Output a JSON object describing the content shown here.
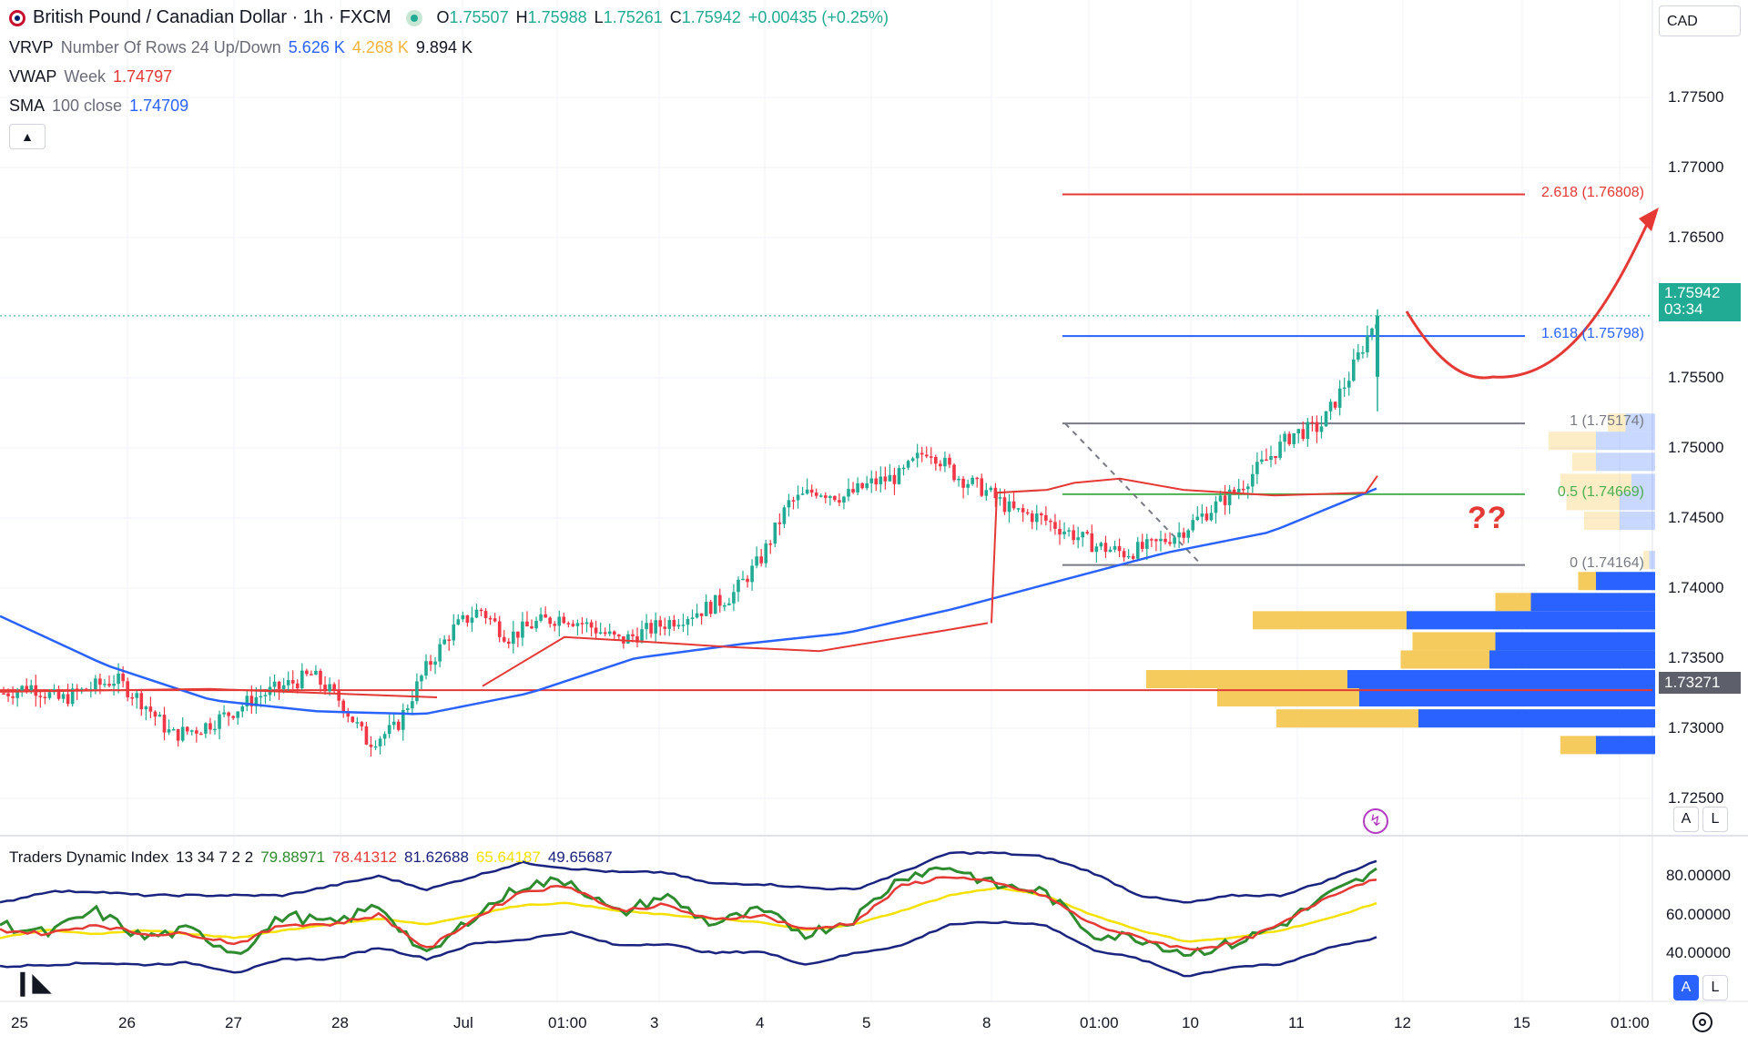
{
  "header": {
    "symbol": "British Pound / Canadian Dollar · 1h · FXCM",
    "open_label": "O",
    "open": "1.75507",
    "high_label": "H",
    "high": "1.75988",
    "low_label": "L",
    "low": "1.75261",
    "close_label": "C",
    "close": "1.75942",
    "change": "+0.00435 (+0.25%)"
  },
  "indicators": {
    "vrvp": {
      "name": "VRVP",
      "params": "Number Of Rows 24 Up/Down",
      "v1": "5.626 K",
      "v2": "4.268 K",
      "v3": "9.894 K"
    },
    "vwap": {
      "name": "VWAP",
      "params": "Week",
      "value": "1.74797"
    },
    "sma": {
      "name": "SMA",
      "params": "100 close",
      "value": "1.74709"
    },
    "tdi": {
      "name": "Traders Dynamic Index",
      "params": "13 34 7 2 2",
      "v1": "79.88971",
      "v2": "78.41312",
      "v3": "81.62688",
      "v4": "65.64187",
      "v5": "49.65687"
    }
  },
  "currency_button": "CAD",
  "price_axis": [
    "1.77500",
    "1.77000",
    "1.76500",
    "1.75500",
    "1.75000",
    "1.74500",
    "1.74000",
    "1.73500",
    "1.73000",
    "1.72500"
  ],
  "current_price": {
    "value": "1.75942",
    "countdown": "03:34"
  },
  "hline_price": "1.73271",
  "fib_levels": [
    {
      "label": "2.618 (1.76808)",
      "price": 1.76808,
      "color": "#e53935"
    },
    {
      "label": "1.618 (1.75798)",
      "price": 1.75798,
      "color": "#2962ff"
    },
    {
      "label": "1 (1.75174)",
      "price": 1.75174,
      "color": "#787b86"
    },
    {
      "label": "0.5 (1.74669)",
      "price": 1.74669,
      "color": "#4caf50"
    },
    {
      "label": "0 (1.74164)",
      "price": 1.74164,
      "color": "#787b86"
    }
  ],
  "annotation_text": "??",
  "tdi_axis": [
    "80.00000",
    "60.00000",
    "40.00000"
  ],
  "time_axis": [
    "25",
    "26",
    "27",
    "28",
    "Jul",
    "01:00",
    "3",
    "4",
    "5",
    "8",
    "01:00",
    "10",
    "11",
    "12",
    "15",
    "01:00"
  ],
  "buttons": {
    "auto": "A",
    "log": "L",
    "auto2": "A",
    "log2": "L"
  },
  "colors": {
    "up": "#22ab94",
    "down": "#f23645",
    "sma": "#2962ff",
    "vwap": "#e53935",
    "vol_up": "#2962ff",
    "vol_down": "#f5c242"
  },
  "chart_data": {
    "type": "candlestick",
    "symbol": "GBPCAD",
    "timeframe": "1h",
    "ylim": [
      1.7235,
      1.78
    ],
    "close_series_approx": [
      1.7325,
      1.733,
      1.732,
      1.7328,
      1.7335,
      1.7318,
      1.7295,
      1.73,
      1.731,
      1.7322,
      1.733,
      1.7338,
      1.732,
      1.729,
      1.73,
      1.734,
      1.737,
      1.7385,
      1.7365,
      1.7375,
      1.738,
      1.7372,
      1.7362,
      1.737,
      1.7378,
      1.7385,
      1.7395,
      1.742,
      1.746,
      1.747,
      1.7465,
      1.7475,
      1.748,
      1.75,
      1.748,
      1.747,
      1.7455,
      1.745,
      1.744,
      1.743,
      1.7425,
      1.743,
      1.744,
      1.7455,
      1.747,
      1.749,
      1.751,
      1.7515,
      1.755,
      1.7594
    ],
    "sma100_approx": [
      1.738,
      1.7345,
      1.732,
      1.7312,
      1.731,
      1.7325,
      1.735,
      1.736,
      1.7368,
      1.7385,
      1.7405,
      1.7425,
      1.744,
      1.7471
    ],
    "volume_profile_rows": [
      {
        "price": 1.7518,
        "up": 0.15,
        "down": 0.25
      },
      {
        "price": 1.7505,
        "up": 0.4,
        "down": 0.5
      },
      {
        "price": 1.749,
        "up": 0.2,
        "down": 0.5
      },
      {
        "price": 1.7475,
        "up": 0.6,
        "down": 0.2
      },
      {
        "price": 1.7462,
        "up": 0.45,
        "down": 0.3
      },
      {
        "price": 1.7448,
        "up": 0.3,
        "down": 0.3
      },
      {
        "price": 1.742,
        "up": 0.05,
        "down": 0.05
      },
      {
        "price": 1.7405,
        "up": 0.15,
        "down": 0.5
      },
      {
        "price": 1.739,
        "up": 0.3,
        "down": 1.05
      },
      {
        "price": 1.7377,
        "up": 1.3,
        "down": 2.1
      },
      {
        "price": 1.7362,
        "up": 0.7,
        "down": 1.35
      },
      {
        "price": 1.7349,
        "up": 0.75,
        "down": 1.4
      },
      {
        "price": 1.7335,
        "up": 1.7,
        "down": 2.6
      },
      {
        "price": 1.7322,
        "up": 1.2,
        "down": 2.5
      },
      {
        "price": 1.7307,
        "up": 1.2,
        "down": 2.0
      },
      {
        "price": 1.7288,
        "up": 0.3,
        "down": 0.5
      }
    ],
    "tdi_series_approx": {
      "rsi_green": [
        55,
        50,
        62,
        48,
        52,
        40,
        60,
        55,
        65,
        38,
        60,
        75,
        78,
        60,
        70,
        55,
        62,
        50,
        58,
        80,
        85,
        75,
        72,
        50,
        48,
        40,
        45,
        55,
        70,
        82
      ],
      "signal_red": [
        52,
        50,
        55,
        50,
        50,
        45,
        55,
        55,
        60,
        42,
        58,
        72,
        75,
        62,
        65,
        57,
        60,
        52,
        56,
        75,
        80,
        76,
        70,
        55,
        48,
        42,
        45,
        55,
        70,
        79
      ],
      "mid_yellow": [
        48,
        52,
        50,
        52,
        50,
        48,
        52,
        55,
        58,
        55,
        60,
        65,
        66,
        62,
        60,
        58,
        56,
        52,
        55,
        62,
        70,
        74,
        70,
        60,
        52,
        46,
        48,
        52,
        58,
        66
      ]
    }
  }
}
